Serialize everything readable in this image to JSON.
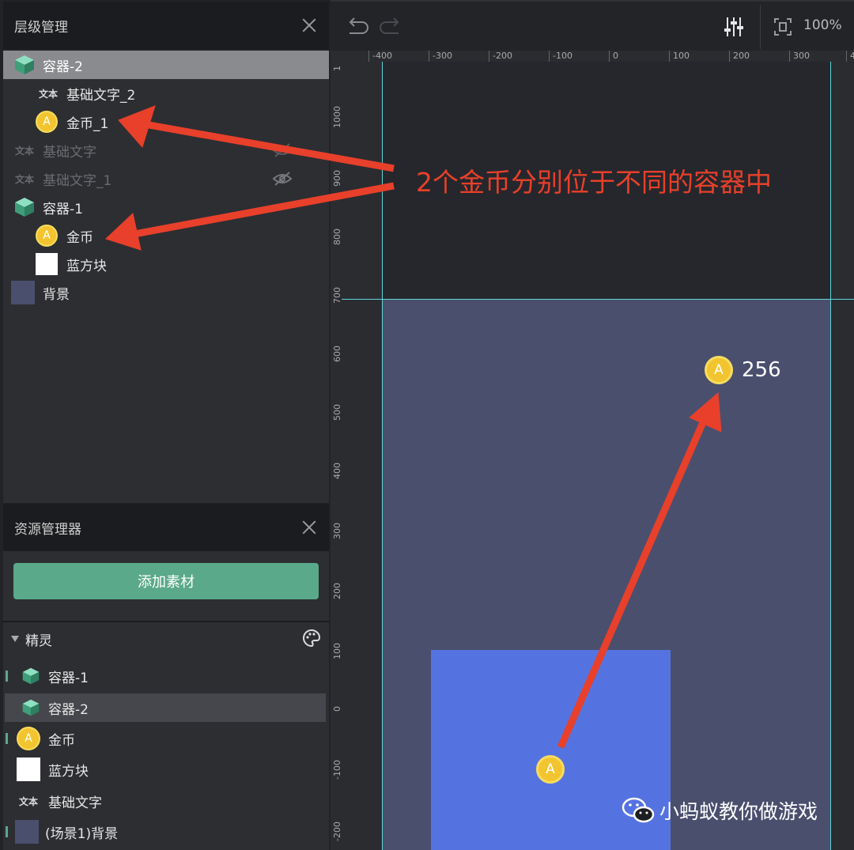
{
  "layer_panel": {
    "title": "层级管理",
    "rows": [
      {
        "label": "容器-2",
        "icon": "container-box-icon"
      },
      {
        "label": "基础文字_2",
        "icon": "text-icon",
        "icon_text": "文本"
      },
      {
        "label": "金币_1",
        "icon": "coin-icon",
        "icon_text": "A"
      },
      {
        "label": "基础文字",
        "icon": "text-icon",
        "icon_text": "文本"
      },
      {
        "label": "基础文字_1",
        "icon": "text-icon",
        "icon_text": "文本"
      },
      {
        "label": "容器-1",
        "icon": "container-box-icon"
      },
      {
        "label": "金币",
        "icon": "coin-icon",
        "icon_text": "A"
      },
      {
        "label": "蓝方块",
        "icon": "white-square-icon"
      },
      {
        "label": "背景",
        "icon": "background-square-icon"
      }
    ]
  },
  "asset_panel": {
    "title": "资源管理器",
    "add_button": "添加素材",
    "section": "精灵",
    "items": [
      {
        "label": "容器-1"
      },
      {
        "label": "容器-2"
      },
      {
        "label": "金币",
        "icon_text": "A"
      },
      {
        "label": "蓝方块"
      },
      {
        "label": "基础文字",
        "icon_text": "文本"
      },
      {
        "label": "(场景1)背景"
      }
    ]
  },
  "toolbar": {
    "zoom": "100%"
  },
  "ruler": {
    "h_ticks": [
      "-400",
      "-300",
      "-200",
      "-100",
      "0",
      "100",
      "200",
      "300",
      "4"
    ],
    "v_ticks": [
      "1",
      "1000",
      "900",
      "800",
      "700",
      "600",
      "500",
      "400",
      "300",
      "200",
      "100",
      "0",
      "-100",
      "-200"
    ]
  },
  "canvas": {
    "score": "256",
    "coin_letter": "A"
  },
  "annotation": {
    "callout": "2个金币分别位于不同的容器中"
  },
  "watermark": {
    "text": "小蚂蚁教你做游戏"
  },
  "colors": {
    "accent_green": "#5aa98a",
    "arrow_red": "#e8402a",
    "coin_yellow": "#f2c530",
    "guide_cyan": "#5fd5d8",
    "stage": "#4a4f6e",
    "blue_block": "#5573e0"
  }
}
